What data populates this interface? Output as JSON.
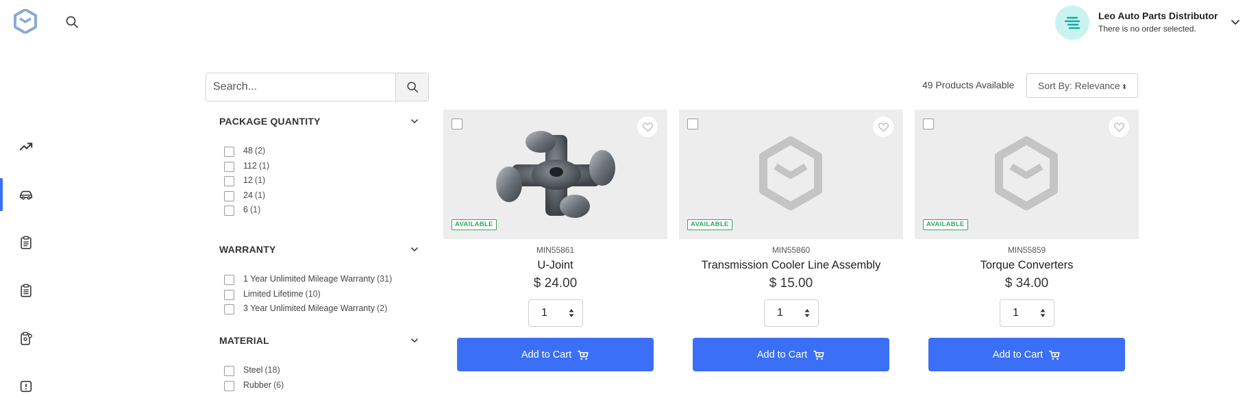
{
  "header": {
    "user_name": "Leo Auto Parts Distributor",
    "user_sub": "There is no order selected."
  },
  "sidebar": {
    "items": [
      {
        "icon": "trending-up-icon",
        "active": false
      },
      {
        "icon": "car-icon",
        "active": true
      },
      {
        "icon": "clipboard-list-icon",
        "active": false
      },
      {
        "icon": "clipboard-icon",
        "active": false
      },
      {
        "icon": "clipboard-user-icon",
        "active": false
      },
      {
        "icon": "alert-icon",
        "active": false
      }
    ]
  },
  "filters": {
    "search_placeholder": "Search...",
    "sections": [
      {
        "title": "PACKAGE QUANTITY",
        "options": [
          {
            "label": "48",
            "count": "(2)"
          },
          {
            "label": "112",
            "count": "(1)"
          },
          {
            "label": "12",
            "count": "(1)"
          },
          {
            "label": "24",
            "count": "(1)"
          },
          {
            "label": "6",
            "count": "(1)"
          }
        ]
      },
      {
        "title": "WARRANTY",
        "options": [
          {
            "label": "1 Year Unlimited Mileage Warranty",
            "count": "(31)"
          },
          {
            "label": "Limited Lifetime",
            "count": "(10)"
          },
          {
            "label": "3 Year Unlimited Mileage Warranty",
            "count": "(2)"
          }
        ]
      },
      {
        "title": "MATERIAL",
        "options": [
          {
            "label": "Steel",
            "count": "(18)"
          },
          {
            "label": "Rubber",
            "count": "(6)"
          }
        ]
      }
    ]
  },
  "results": {
    "count_label": "49 Products Available",
    "sort_label": "Sort By: Relevance"
  },
  "products": [
    {
      "sku": "MIN55861",
      "name": "U-Joint",
      "price": "$ 24.00",
      "status": "AVAILABLE",
      "qty": "1",
      "cart_label": "Add to Cart",
      "image": "u-joint"
    },
    {
      "sku": "MIN55860",
      "name": "Transmission Cooler Line Assembly",
      "price": "$ 15.00",
      "status": "AVAILABLE",
      "qty": "1",
      "cart_label": "Add to Cart",
      "image": "placeholder"
    },
    {
      "sku": "MIN55859",
      "name": "Torque Converters",
      "price": "$ 34.00",
      "status": "AVAILABLE",
      "qty": "1",
      "cart_label": "Add to Cart",
      "image": "placeholder"
    }
  ],
  "colors": {
    "accent": "#3b6ff6",
    "available": "#2ea95b",
    "avatar_bg": "#c9f3f0",
    "logo": "#8aa9d8"
  }
}
